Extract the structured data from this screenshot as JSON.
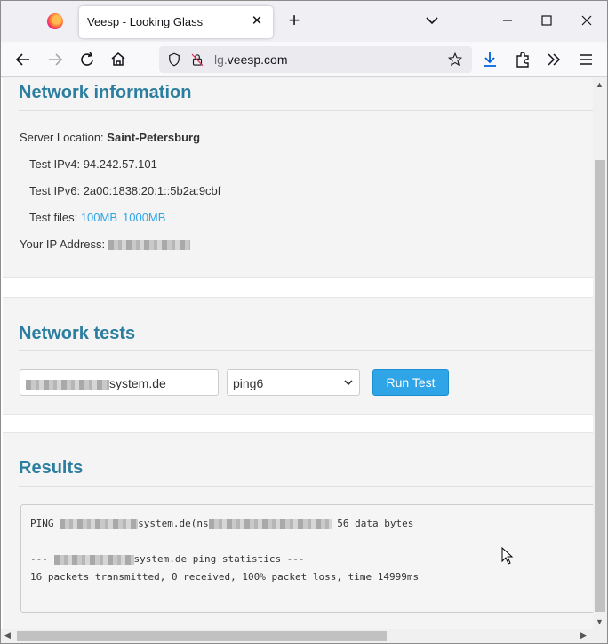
{
  "browser": {
    "tab_title": "Veesp - Looking Glass",
    "close_tab": "✕",
    "new_tab": "+",
    "url_prefix": "lg.",
    "url_domain": "veesp.com"
  },
  "network_info": {
    "heading": "Network information",
    "server_location_label": "Server Location:",
    "server_location_value": "Saint-Petersburg",
    "ipv4_label": "Test IPv4:",
    "ipv4_value": "94.242.57.101",
    "ipv6_label": "Test IPv6:",
    "ipv6_value": "2a00:1838:20:1::5b2a:9cbf",
    "files_label": "Test files:",
    "file_links": [
      "100MB",
      "1000MB"
    ],
    "your_ip_label": "Your IP Address:"
  },
  "network_tests": {
    "heading": "Network tests",
    "host_input_visible_suffix": "system.de",
    "method_selected": "ping6",
    "run_button": "Run Test"
  },
  "results": {
    "heading": "Results",
    "line1_prefix": "PING ",
    "line1_host_suffix": "system.de(ns",
    "line1_tail": " 56 data bytes",
    "line2_prefix": "--- ",
    "line2_host_suffix": "system.de ping statistics ---",
    "line3": "16 packets transmitted, 0 received, 100% packet loss, time 14999ms"
  },
  "colors": {
    "heading": "#2c7ea0",
    "link": "#2fa4e7",
    "button": "#2fa4e7"
  }
}
